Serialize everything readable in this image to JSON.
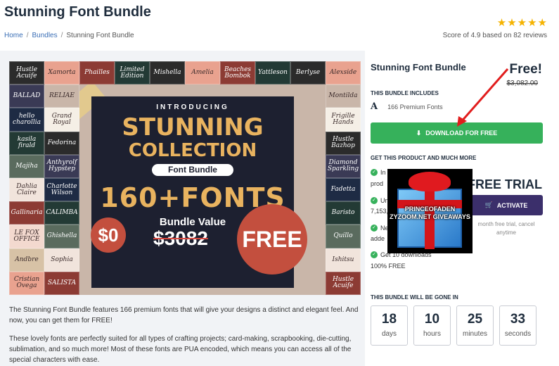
{
  "page": {
    "title": "Stunning Font Bundle",
    "rating_stars": 5,
    "score_text": "Score of 4.9 based on 82 reviews"
  },
  "breadcrumb": {
    "home": "Home",
    "bundles": "Bundles",
    "current": "Stunning Font Bundle",
    "separator": "/"
  },
  "hero": {
    "intro": "INTRODUCING",
    "line1": "STUNNING",
    "line2": "COLLECTION",
    "pill": "Font Bundle",
    "big": "160+FONTS",
    "bundle_value": "Bundle Value",
    "old_value": "$3082",
    "zero": "$0",
    "free": "FREE",
    "tiles": [
      "Hustle Acuife",
      "Xamorta",
      "Phailles",
      "Limited Edition",
      "Mishella",
      "Amelia",
      "Beaches Bombok",
      "Yattleson",
      "Berlyse",
      "Alexside",
      "BALLAD",
      "RELIAE",
      "Montilda",
      "hello charollia",
      "Grand Royal",
      "Frigille Hands",
      "kasila firald",
      "Fedorina",
      "Hustle Bazhop",
      "Majiha",
      "Anthyrolf Hypstep",
      "Diamond Sparkling",
      "Dahlia Claire",
      "Charlotte Wilson",
      "Fadetta",
      "Gallinaria",
      "CALIMBA",
      "Baristo",
      "LE FOX OFFICE",
      "Ghishella",
      "Quillo",
      "Andbre",
      "Sophia",
      "Ishitsu",
      "Cristian Ovega",
      "SALISTA"
    ]
  },
  "description": {
    "p1": "The Stunning Font Bundle features 166 premium fonts that will give your designs a distinct and elegant feel. And now, you can get them for FREE!",
    "p2": "These lovely fonts are perfectly suited for all types of crafting projects; card-making, scrapbooking, die-cutting, sublimation, and so much more! Most of these fonts are PUA encoded, which means you can access all of the special characters with ease."
  },
  "sidebar": {
    "title": "Stunning Font Bundle",
    "price_free": "Free!",
    "price_old": "$3,082.00",
    "includes_label": "THIS BUNDLE INCLUDES",
    "includes_icon": "A",
    "includes_text": "166 Premium Fonts",
    "download_label": "DOWNLOAD FOR FREE",
    "more_label": "GET THIS PRODUCT AND MUCH MORE",
    "features": [
      "In",
      "prod",
      "Un",
      "7,153,",
      "Ne",
      "adde",
      "Get 10 downloads",
      "100% FREE"
    ],
    "free_trial": "FREE TRIAL",
    "activate_label": "ACTIVATE",
    "trial_note": "month free trial, cancel anytime",
    "gift_overlay": "PRINCEOFADEN ZYZOOM.NET GIVEAWAYS",
    "gone_label": "THIS BUNDLE WILL BE GONE IN",
    "timer": [
      {
        "value": "18",
        "unit": "days"
      },
      {
        "value": "10",
        "unit": "hours"
      },
      {
        "value": "25",
        "unit": "minutes"
      },
      {
        "value": "33",
        "unit": "seconds"
      }
    ]
  },
  "colors": {
    "green": "#36b15b",
    "purple": "#3b2f6b",
    "star": "#f5b301",
    "link": "#3b6fb6",
    "hero_accent": "#e9b35f",
    "arrow": "#e11d1d"
  }
}
